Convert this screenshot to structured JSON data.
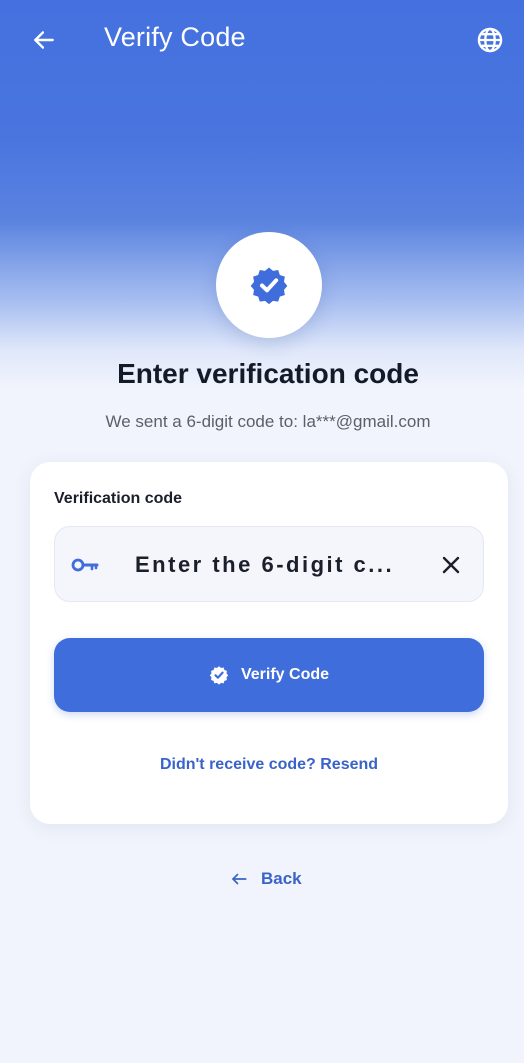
{
  "app_bar": {
    "title": "Verify Code",
    "back_icon": "arrow-left-icon",
    "language_icon": "globe-icon"
  },
  "hero": {
    "badge_icon": "verified-badge-icon",
    "heading": "Enter verification code",
    "subtext": "We sent a 6-digit code to: la***@gmail.com"
  },
  "form": {
    "field_label": "Verification code",
    "code_input": {
      "placeholder": "Enter the 6-digit c...",
      "value": "",
      "leading_icon": "key-icon",
      "trailing_icon": "close-icon"
    },
    "verify_button": {
      "label": "Verify Code",
      "icon": "verified-badge-icon"
    },
    "resend_link": "Didn't receive code? Resend"
  },
  "footer": {
    "back_label": "Back",
    "back_icon": "arrow-left-icon"
  },
  "colors": {
    "primary": "#3f6ddb",
    "header_blue": "#4471df",
    "link": "#3a63c9",
    "background": "#f1f4fc",
    "heading_text": "#141a28"
  }
}
